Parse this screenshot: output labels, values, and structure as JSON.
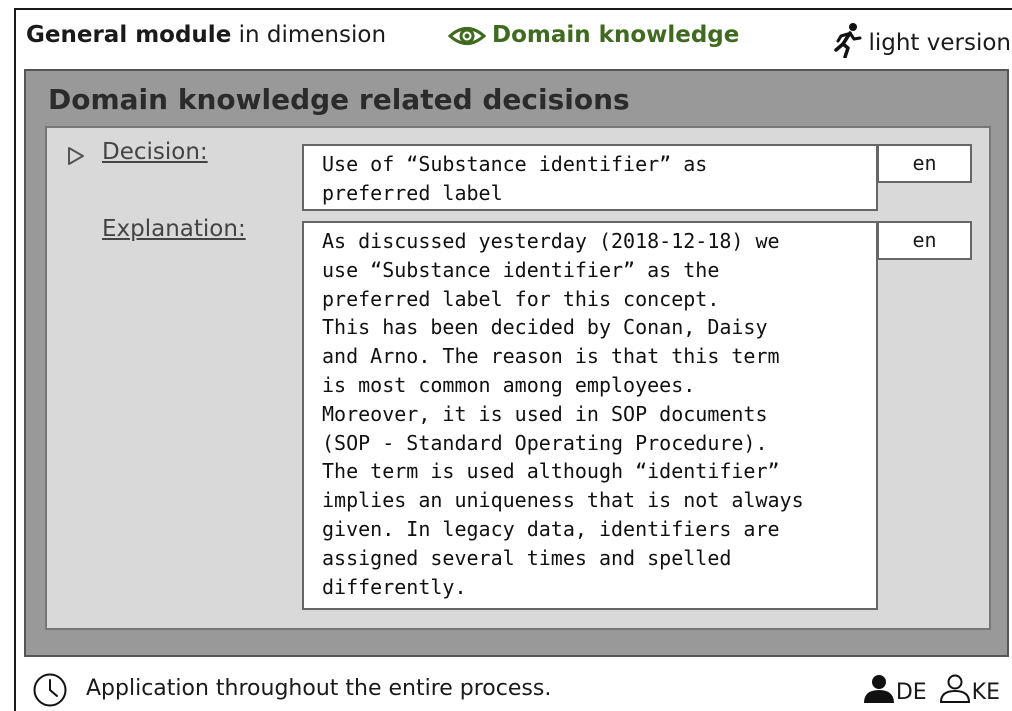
{
  "header": {
    "module_bold": "General module",
    "module_rest": " in dimension",
    "dimension": "Domain knowledge",
    "version_first": "l",
    "version_rest": "ight version"
  },
  "panel": {
    "title": "Domain knowledge related decisions"
  },
  "decision": {
    "label": "Decision:",
    "text": "Use of “Substance identifier” as\npreferred label",
    "language": "en"
  },
  "explanation": {
    "label": "Explanation:",
    "text": "As discussed yesterday (2018-12-18) we\nuse “Substance identifier” as the\npreferred label for this concept.\nThis has been decided by Conan, Daisy\nand Arno. The reason is that this term\nis most common among employees.\nMoreover, it is used in SOP documents\n(SOP - Standard Operating Procedure).\nThe term is used although “identifier”\nimplies an uniqueness that is not always\ngiven. In legacy data, identifiers are\nassigned several times and spelled\ndifferently.",
    "language": "en"
  },
  "footer": {
    "text": "Application throughout the entire process.",
    "role_primary": "DE",
    "role_secondary": "KE"
  },
  "colors": {
    "dimension_green": "#3f6a20",
    "outer_panel": "#999999",
    "inner_panel": "#d9d9d9"
  },
  "icons": {
    "dimension": "eye-icon",
    "version": "runner-icon",
    "decision": "triangle-right-icon",
    "footer": "clock-icon",
    "role_primary": "person-filled-icon",
    "role_secondary": "person-outline-icon"
  }
}
